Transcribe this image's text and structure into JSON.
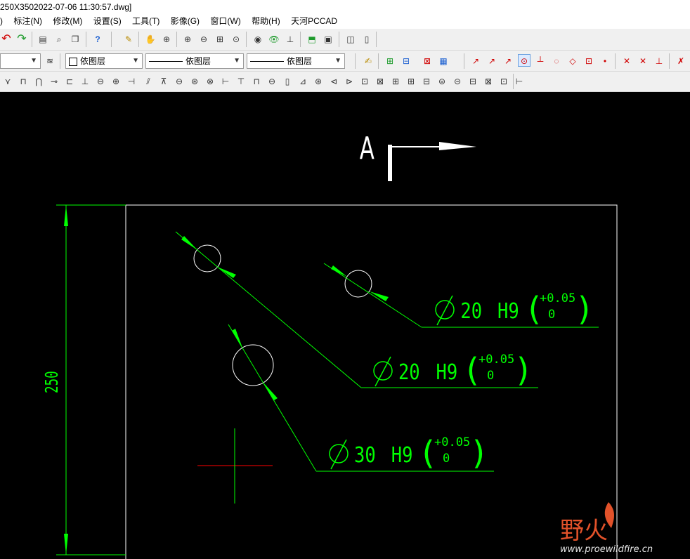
{
  "window": {
    "title": "250X3502022-07-06 11:30:57.dwg]"
  },
  "menu": {
    "items": [
      ")",
      "标注(N)",
      "修改(M)",
      "设置(S)",
      "工具(T)",
      "影像(G)",
      "窗口(W)",
      "帮助(H)",
      "天河PCCAD"
    ]
  },
  "toolbar2": {
    "layer_color_label": "依图层",
    "linetype_label": "依图层",
    "lineweight_label": "依图层"
  },
  "drawing": {
    "section_letter": "A",
    "vertical_dim": "250",
    "callouts": [
      {
        "diameter": "20",
        "fit": "H9",
        "upper": "+0.05",
        "lower": "0"
      },
      {
        "diameter": "20",
        "fit": "H9",
        "upper": "+0.05",
        "lower": "0"
      },
      {
        "diameter": "30",
        "fit": "H9",
        "upper": "+0.05",
        "lower": "0"
      }
    ]
  },
  "watermark": {
    "brand": "野火",
    "url": "www.proewildfire.cn"
  },
  "colors": {
    "annotation": "#00ff00",
    "geometry": "#ffffff",
    "centerline": "#ff0000",
    "watermark": "#e2522a"
  },
  "icons": {
    "toolbar1": [
      "undo-icon",
      "redo-icon",
      "list-icon",
      "find-icon",
      "copy-icon",
      "help-icon",
      "pen-icon",
      "pan-icon",
      "zoom-realtime-icon",
      "zoom-in-icon",
      "zoom-out-icon",
      "zoom-window-icon",
      "zoom-extents-icon",
      "view-icon",
      "eye-icon",
      "axis-icon",
      "box-icon",
      "render-icon",
      "split-view-icon",
      "page-icon"
    ]
  }
}
